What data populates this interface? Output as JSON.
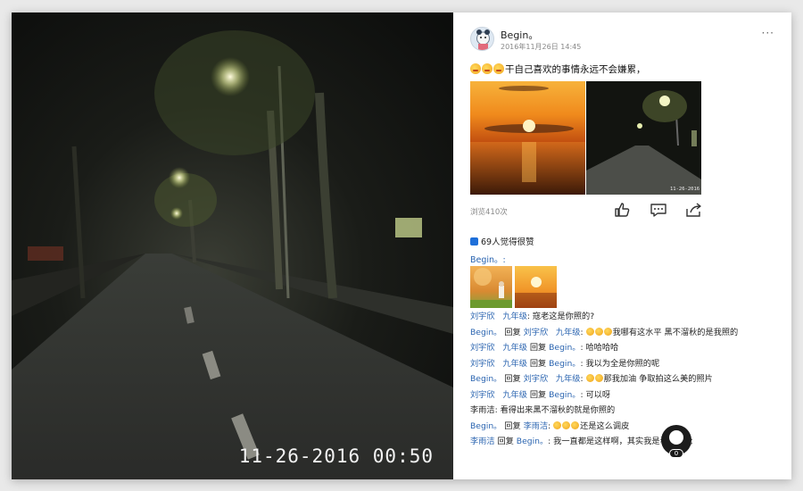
{
  "photo": {
    "timestamp": "11-26-2016 00:50"
  },
  "post": {
    "author": "Begin。",
    "time": "2016年11月26日 14:45",
    "more_icon": "ellipsis-icon",
    "text": "干自己喜欢的事情永远不会嫌累，",
    "emoji_count": 3,
    "images": [
      "sunset-sea-image",
      "night-street-image"
    ],
    "thumb_timestamp": "11-26-2016",
    "views": "浏览410次",
    "actions": [
      "like-icon",
      "comment-icon",
      "share-icon"
    ]
  },
  "likes": {
    "text": "69人觉得很赞"
  },
  "reply": {
    "author": "Begin。:"
  },
  "comments": [
    {
      "name": "刘宇欣",
      "grade": "九年级",
      "text": ": 寇老这是你照的?"
    },
    {
      "name": "Begin。",
      "reply_word": "回复",
      "target": "刘宇欣",
      "grade": "九年级",
      "text": "我哪有这水平 黑不溜秋的是我照的"
    },
    {
      "name": "刘宇欣",
      "grade": "九年级",
      "reply_word": "回复",
      "target": "Begin。",
      "text": ": 哈哈哈哈"
    },
    {
      "name": "刘宇欣",
      "grade": "九年级",
      "reply_word": "回复",
      "target": "Begin。",
      "text": ": 我以为全是你照的呢"
    },
    {
      "name": "Begin。",
      "reply_word": "回复",
      "target": "刘宇欣",
      "grade": "九年级",
      "text": "那我加油 争取拍这么美的照片"
    },
    {
      "name": "刘宇欣",
      "grade": "九年级",
      "reply_word": "回复",
      "target": "Begin。",
      "text": ": 可以呀"
    },
    {
      "name": "李雨洁",
      "text": ": 看得出来黑不溜秋的就是你照的"
    },
    {
      "name": "Begin。",
      "reply_word": "回复",
      "target": "李雨洁",
      "text": "还是这么调皮"
    },
    {
      "name": "李雨洁",
      "reply_word": "回复",
      "target": "Begin。",
      "text": ": 我一直都是这样啊，其实我是看了评论"
    }
  ],
  "floating": {
    "count": "0"
  },
  "colors": {
    "link": "#2a64b0",
    "like": "#1e6fd9"
  }
}
